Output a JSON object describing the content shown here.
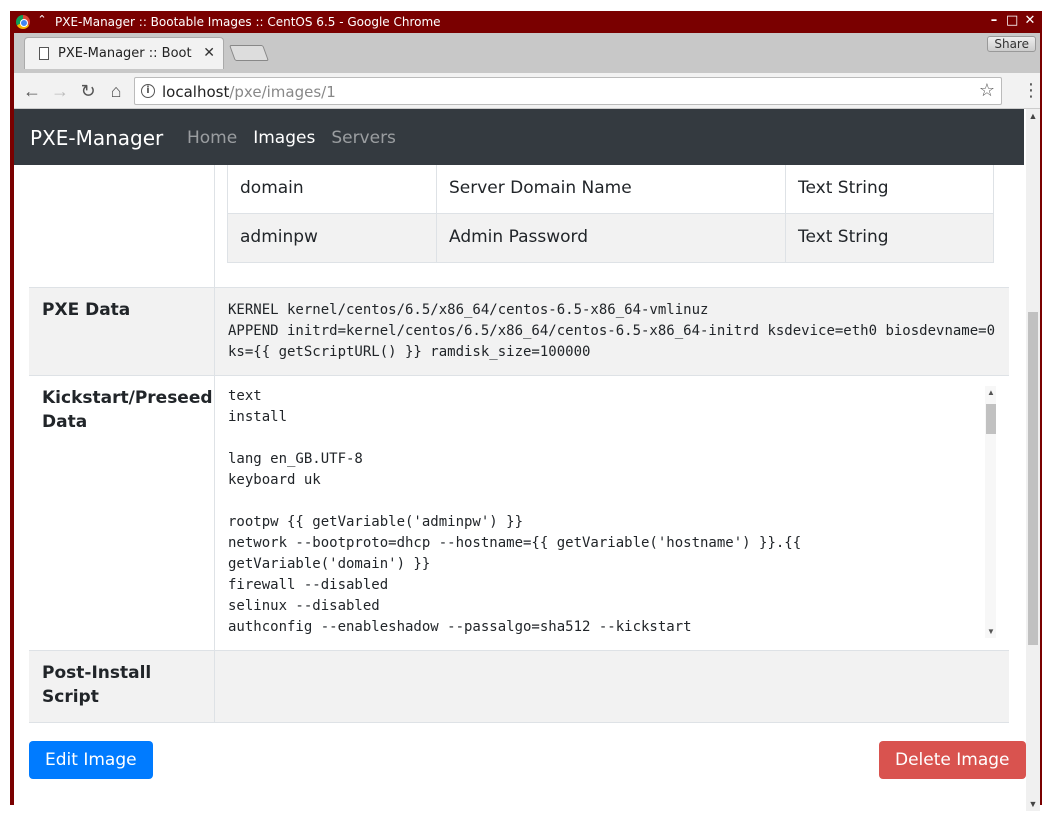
{
  "window": {
    "title": "PXE-Manager :: Bootable Images :: CentOS 6.5 - Google Chrome",
    "controls": [
      "–",
      "□",
      "✕"
    ]
  },
  "tab": {
    "title": "PXE-Manager :: Boot",
    "close": "✕"
  },
  "share_label": "Share",
  "address": {
    "host": "localhost",
    "path": "/pxe/images/1"
  },
  "navbar": {
    "brand": "PXE-Manager",
    "links": [
      "Home",
      "Images",
      "Servers"
    ],
    "active": "Images"
  },
  "variables": [
    {
      "name": "domain",
      "description": "Server Domain Name",
      "type": "Text String"
    },
    {
      "name": "adminpw",
      "description": "Admin Password",
      "type": "Text String"
    }
  ],
  "pxe": {
    "label": "PXE Data",
    "text": "KERNEL kernel/centos/6.5/x86_64/centos-6.5-x86_64-vmlinuz\nAPPEND initrd=kernel/centos/6.5/x86_64/centos-6.5-x86_64-initrd ksdevice=eth0 biosdevname=0\nks={{ getScriptURL() }} ramdisk_size=100000"
  },
  "kickstart": {
    "label": "Kickstart/Preseed Data",
    "text": "text\ninstall\n\nlang en_GB.UTF-8\nkeyboard uk\n\nrootpw {{ getVariable('adminpw') }}\nnetwork --bootproto=dhcp --hostname={{ getVariable('hostname') }}.{{\ngetVariable('domain') }}\nfirewall --disabled\nselinux --disabled\nauthconfig --enableshadow --passalgo=sha512 --kickstart"
  },
  "post_install": {
    "label": "Post-Install Script"
  },
  "buttons": {
    "edit": "Edit Image",
    "delete": "Delete Image"
  },
  "colors": {
    "navbar": "#343a40",
    "primary": "#007bff",
    "danger": "#d9534f",
    "frame": "#7a0000"
  }
}
